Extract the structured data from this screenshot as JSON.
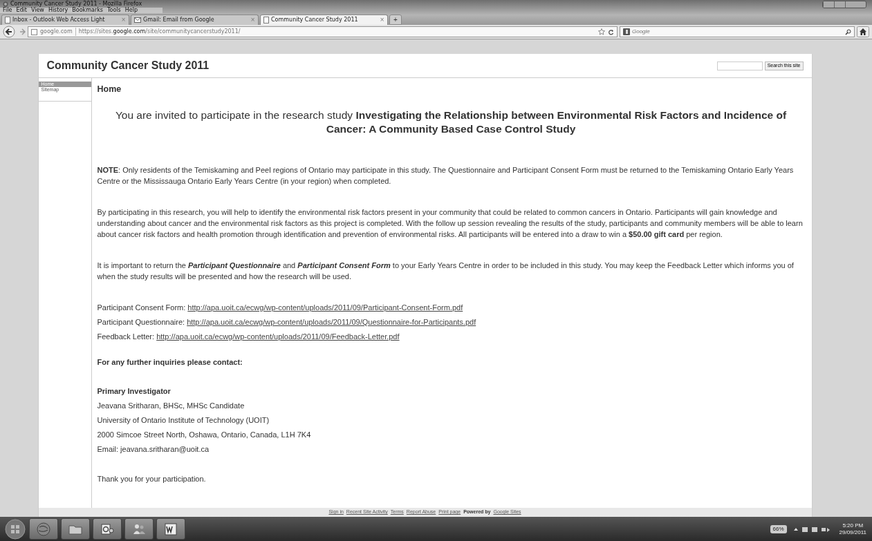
{
  "window": {
    "title": "Community Cancer Study 2011 - Mozilla Firefox"
  },
  "menu": [
    {
      "label": "File"
    },
    {
      "label": "Edit"
    },
    {
      "label": "View"
    },
    {
      "label": "History"
    },
    {
      "label": "Bookmarks"
    },
    {
      "label": "Tools"
    },
    {
      "label": "Help"
    }
  ],
  "tabs": [
    {
      "label": "Inbox - Outlook Web Access Light",
      "kind": "page",
      "selected": false
    },
    {
      "label": "Gmail: Email from Google",
      "kind": "mail",
      "selected": false
    },
    {
      "label": "Community Cancer Study 2011",
      "kind": "page",
      "selected": true
    }
  ],
  "tab_close": "×",
  "new_tab": "+",
  "address": {
    "site": "google.com",
    "url_pre": "https://sites.",
    "url_domain": "google.com",
    "url_post": "/site/communitycancerstudy2011/"
  },
  "search": {
    "placeholder": "Google"
  },
  "site": {
    "title": "Community Cancer Study 2011",
    "search_button": "Search this site",
    "sidebar": [
      {
        "label": "Home",
        "selected": true
      },
      {
        "label": "Sitemap",
        "selected": false
      }
    ],
    "page_title": "Home",
    "intro": "You are invited to participate in the research study **Investigating the Relationship between Environmental Risk Factors and Incidence of Cancer: A Community Based Case Control Study**",
    "paragraphs": [
      "**NOTE**: Only residents of the Temiskaming and Peel regions of Ontario may participate in this study. The Questionnaire and Participant Consent Form must be returned to the Temiskaming Ontario Early Years Centre or the Mississauga Ontario Early Years Centre (in your region) when completed.",
      "By participating in this research, you will help to identify the environmental risk factors present in your community that could be related to common cancers in Ontario. Participants will gain knowledge and understanding about cancer and the environmental risk factors as this project is completed. With the follow up session revealing the results of the study, participants and community members will be able to learn about cancer risk factors and health promotion through identification and prevention of environmental risks. All participants will be entered into a draw to win a **$50.00 gift card** per region.",
      [
        {
          "text": "It is important to return the ",
          "emphasis": false
        },
        {
          "text": "Participant Questionnaire",
          "emphasis": true
        },
        {
          "text": " and ",
          "emphasis": false
        },
        {
          "text": "Participant Consent Form",
          "emphasis": true
        },
        {
          "text": " to your Early Years Centre in order to be included in this study. You may keep the Feedback Letter which informs you of when the study results will be presented and how the research will be used.",
          "emphasis": false
        }
      ]
    ],
    "documents": [
      {
        "label": "Participant Consent Form:",
        "url": "http://apa.uoit.ca/ecwg/wp-content/uploads/2011/09/Participant-Consent-Form.pdf"
      },
      {
        "label": "Participant Questionnaire:",
        "url": "http://apa.uoit.ca/ecwg/wp-content/uploads/2011/09/Questionnaire-for-Participants.pdf"
      },
      {
        "label": "Feedback Letter:",
        "url": "http://apa.uoit.ca/ecwg/wp-content/uploads/2011/09/Feedback-Letter.pdf"
      }
    ],
    "contact_heading": "For any further inquiries please contact:",
    "investigator_heading": "Primary Investigator",
    "contact_lines": [
      "Jeavana Sritharan, BHSc, MHSc Candidate",
      "University of Ontario Institute of Technology (UOIT)",
      "2000 Simcoe Street North, Oshawa, Ontario, Canada, L1H 7K4",
      "Email: jeavana.sritharan@uoit.ca"
    ],
    "thanks": "Thank you for your participation.",
    "footer_links": [
      "Sign in",
      "Recent Site Activity",
      "Terms",
      "Report Abuse",
      "Print page"
    ],
    "footer_powered": "Powered by",
    "footer_powered_link": "Google Sites"
  },
  "taskbar": {
    "apps": [
      {
        "kind": "browser"
      },
      {
        "kind": "folder"
      },
      {
        "kind": "mail"
      },
      {
        "kind": "messenger"
      },
      {
        "kind": "word"
      }
    ],
    "battery": "66%",
    "time": "5:20 PM",
    "date": "29/09/2011"
  }
}
